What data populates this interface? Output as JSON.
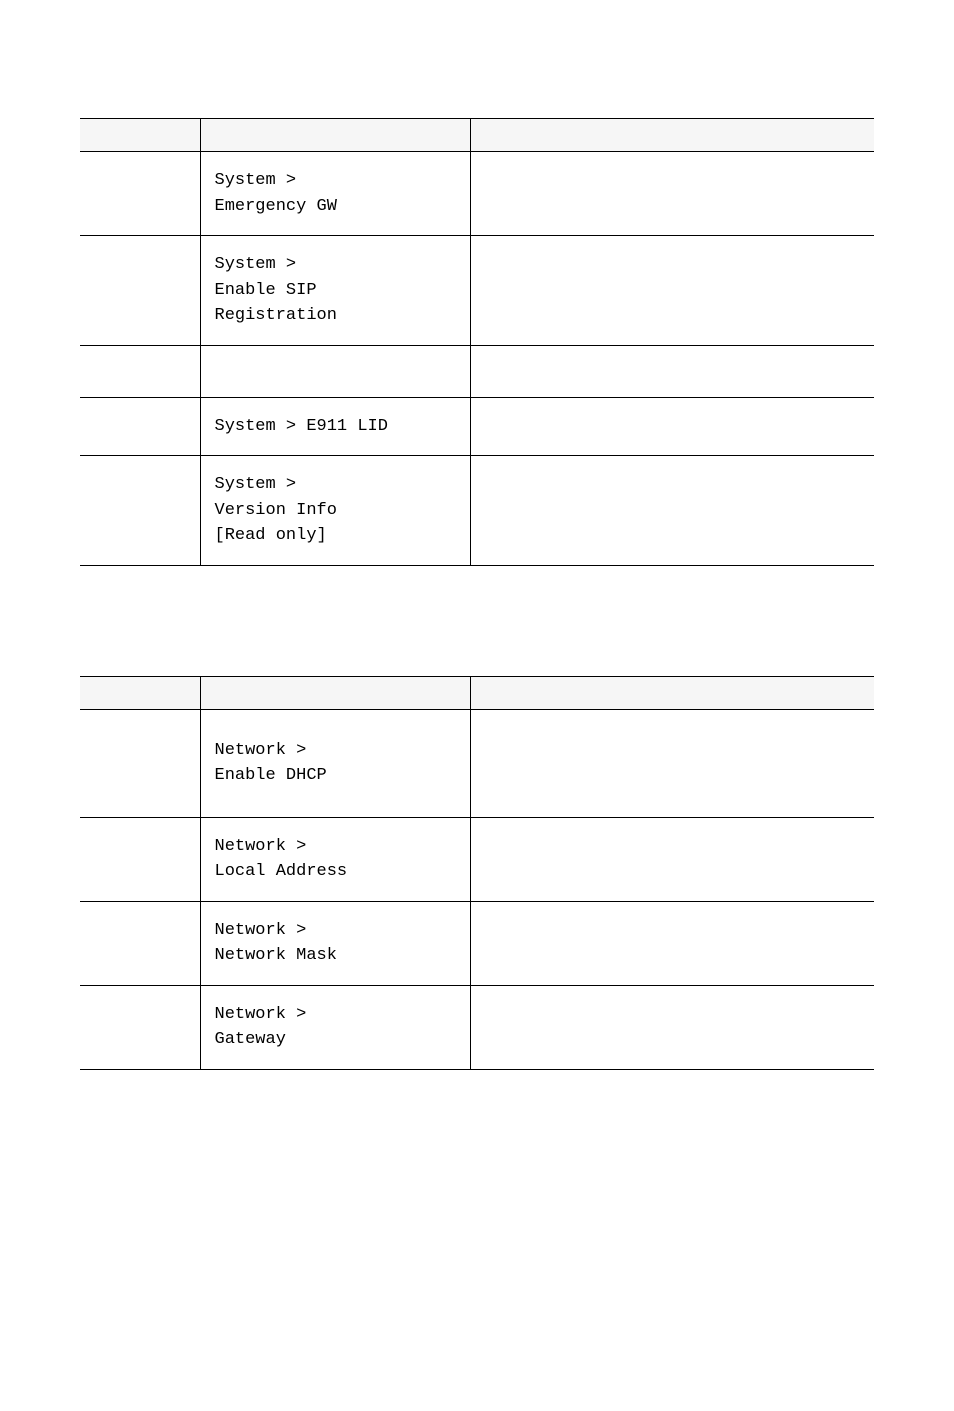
{
  "table1": {
    "rows": [
      {
        "col1": "",
        "col2": "System >\nEmergency GW",
        "col3": ""
      },
      {
        "col1": "",
        "col2": "System >\nEnable SIP\nRegistration",
        "col3": ""
      },
      {
        "col1": "",
        "col2": "",
        "col3": ""
      },
      {
        "col1": "",
        "col2": "System > E911 LID",
        "col3": ""
      },
      {
        "col1": "",
        "col2": "System >\nVersion Info\n[Read only]",
        "col3": ""
      }
    ]
  },
  "table2": {
    "rows": [
      {
        "col1": "",
        "col2": "Network >\nEnable DHCP",
        "col3": ""
      },
      {
        "col1": "",
        "col2": "Network >\nLocal Address",
        "col3": ""
      },
      {
        "col1": "",
        "col2": "Network >\nNetwork Mask",
        "col3": ""
      },
      {
        "col1": "",
        "col2": "Network >\nGateway",
        "col3": ""
      }
    ]
  }
}
